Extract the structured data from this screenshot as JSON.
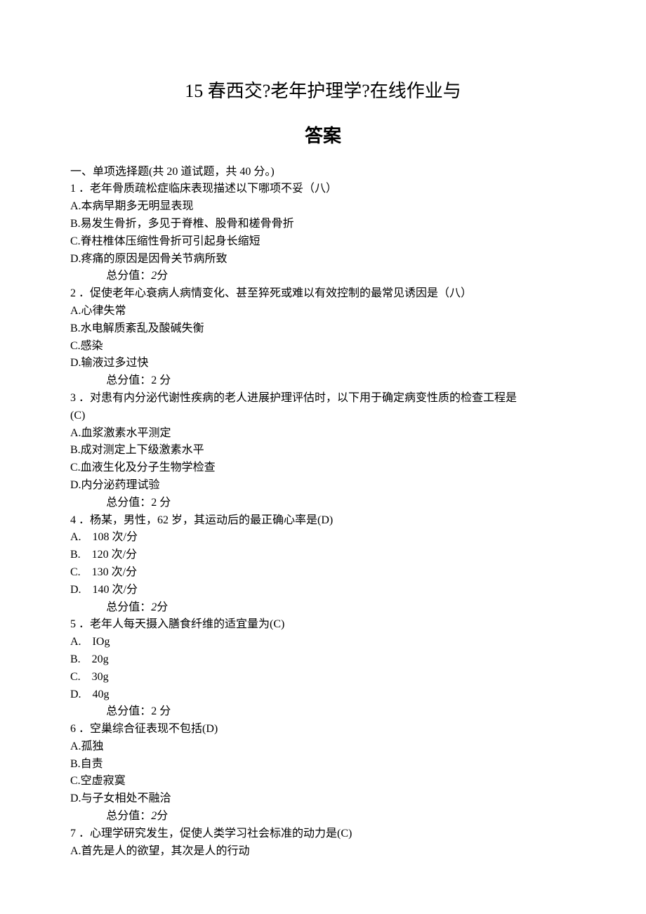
{
  "title_h1": "15 春西交?老年护理学?在线作业与",
  "title_h2": "答案",
  "section_header": "一、单项选择题(共 20 道试题，共 40 分。)",
  "score_normal": "总分值：2 分",
  "score_italic_prefix": "总分值：",
  "score_italic_val": "2",
  "score_italic_suffix": "分",
  "questions": [
    {
      "num": "1",
      "stem": "．老年骨质疏松症临床表现描述以下哪项不妥（八）",
      "opts": [
        "A.本病早期多无明显表现",
        "B.易发生骨折，多见于脊椎、股骨和槎骨骨折",
        "C.脊柱椎体压缩性骨折可引起身长缩短",
        "D.疼痛的原因是因骨关节病所致"
      ],
      "score_style": "italic"
    },
    {
      "num": "2",
      "stem": "．促使老年心衰病人病情变化、甚至猝死或难以有效控制的最常见诱因是（八）",
      "opts": [
        "A.心律失常",
        "B.水电解质紊乱及酸碱失衡",
        "C.感染",
        "D.输液过多过快"
      ],
      "score_style": "normal"
    },
    {
      "num": "3",
      "stem_line1": "．对患有内分泌代谢性疾病的老人进展护理评估时，以下用于确定病变性质的检查工程是",
      "stem_line2": "(C)",
      "opts": [
        "A.血浆激素水平测定",
        "B.成对测定上下级激素水平",
        "C.血液生化及分子生物学检查",
        "D.内分泌药理试验"
      ],
      "score_style": "normal"
    },
    {
      "num": "4",
      "stem": "．杨某，男性，62 岁，其运动后的最正确心率是(D)",
      "opts": [
        "A.　108 次/分",
        "B.　120 次/分",
        "C.　130 次/分",
        "D.　140 次/分"
      ],
      "score_style": "italic"
    },
    {
      "num": "5",
      "stem": "．老年人每天摄入膳食纤维的适宜量为(C)",
      "opts": [
        "A.　IOg",
        "B.　20g",
        "C.　30g",
        "D.　40g"
      ],
      "score_style": "normal"
    },
    {
      "num": "6",
      "stem": "．空巢综合征表现不包括(D)",
      "opts": [
        "A.孤独",
        "B.自责",
        "C.空虚寂寞",
        "D.与子女相处不融洽"
      ],
      "score_style": "italic"
    },
    {
      "num": "7",
      "stem": "．心理学研究发生，促使人类学习社会标准的动力是(C)",
      "opts": [
        "A.首先是人的欲望，其次是人的行动"
      ],
      "score_style": "none"
    }
  ]
}
